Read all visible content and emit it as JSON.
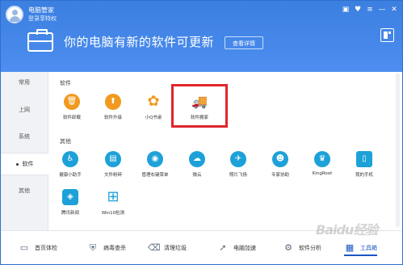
{
  "header": {
    "app_title": "电脑管家",
    "login_link": "登录享特权",
    "banner_text": "你的电脑有新的软件可更新",
    "details_button": "查看详情",
    "controls": [
      "▣",
      "♥",
      "≡",
      "—",
      "✕"
    ]
  },
  "sidebar": {
    "items": [
      {
        "label": "常用"
      },
      {
        "label": "上网"
      },
      {
        "label": "系统"
      },
      {
        "label": "软件"
      },
      {
        "label": "其他"
      }
    ]
  },
  "main": {
    "software": {
      "title": "软件",
      "tools": [
        {
          "label": "软件卸载",
          "icon": "trash-icon",
          "glyph": "🗑"
        },
        {
          "label": "软件升级",
          "icon": "upgrade-arrow-icon",
          "glyph": "⬆"
        },
        {
          "label": "小Q书桌",
          "icon": "clover-icon",
          "glyph": "✿"
        },
        {
          "label": "软件搬家",
          "icon": "moving-truck-icon",
          "glyph": "🚚"
        }
      ]
    },
    "other": {
      "title": "其他",
      "tools": [
        {
          "label": "健康小助手",
          "icon": "health-icon",
          "glyph": "♿"
        },
        {
          "label": "文件粉碎",
          "icon": "shredder-icon",
          "glyph": "▤"
        },
        {
          "label": "管理右键菜单",
          "icon": "mouse-icon",
          "glyph": "◉"
        },
        {
          "label": "微云",
          "icon": "cloud-icon",
          "glyph": "☁"
        },
        {
          "label": "照片飞扬",
          "icon": "bird-icon",
          "glyph": "✈"
        },
        {
          "label": "专家协助",
          "icon": "expert-icon",
          "glyph": "☻"
        },
        {
          "label": "KingRoot",
          "icon": "kingroot-icon",
          "glyph": "♛"
        },
        {
          "label": "我的手机",
          "icon": "phone-icon",
          "glyph": "▯"
        },
        {
          "label": "腾讯新闻",
          "icon": "news-icon",
          "glyph": "◈"
        },
        {
          "label": "Win10检测",
          "icon": "windows-icon",
          "glyph": "⊞"
        }
      ]
    }
  },
  "footer": {
    "items": [
      {
        "label": "首页体检",
        "icon": "monitor-icon",
        "glyph": "▭"
      },
      {
        "label": "病毒查杀",
        "icon": "shield-icon",
        "glyph": "⛨"
      },
      {
        "label": "清理垃圾",
        "icon": "broom-icon",
        "glyph": "⌫"
      },
      {
        "label": "电脑加速",
        "icon": "rocket-icon",
        "glyph": "➚"
      },
      {
        "label": "软件分析",
        "icon": "gear-icon",
        "glyph": "⚙"
      },
      {
        "label": "工具箱",
        "icon": "toolbox-icon",
        "glyph": "▦"
      }
    ]
  },
  "watermark": "Baidu经验",
  "colors": {
    "header": "#4a8bee",
    "orange": "#f19a1f",
    "blue": "#1da1d8",
    "highlight": "#e0262a"
  }
}
